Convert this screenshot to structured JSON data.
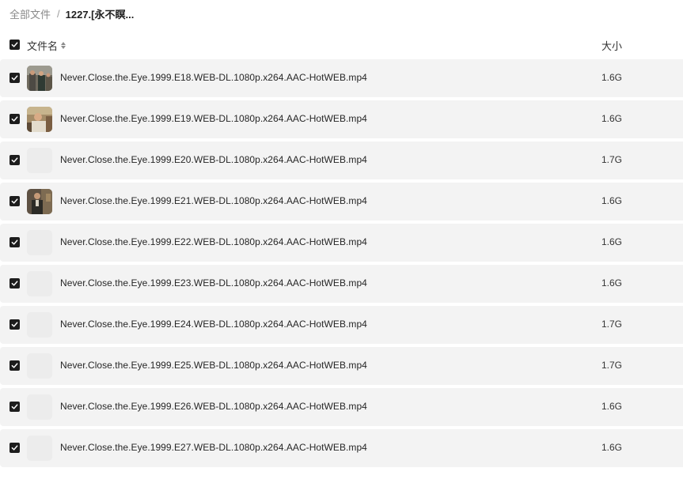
{
  "breadcrumb": {
    "root": "全部文件",
    "separator": "/",
    "current": "1227.[永不瞑..."
  },
  "header": {
    "name_label": "文件名",
    "size_label": "大小",
    "select_all_checked": true
  },
  "files": [
    {
      "name": "Never.Close.the.Eye.1999.E18.WEB-DL.1080p.x264.AAC-HotWEB.mp4",
      "size": "1.6G",
      "thumb": "scene-a",
      "checked": true
    },
    {
      "name": "Never.Close.the.Eye.1999.E19.WEB-DL.1080p.x264.AAC-HotWEB.mp4",
      "size": "1.6G",
      "thumb": "scene-b",
      "checked": true
    },
    {
      "name": "Never.Close.the.Eye.1999.E20.WEB-DL.1080p.x264.AAC-HotWEB.mp4",
      "size": "1.7G",
      "thumb": "placeholder",
      "checked": true
    },
    {
      "name": "Never.Close.the.Eye.1999.E21.WEB-DL.1080p.x264.AAC-HotWEB.mp4",
      "size": "1.6G",
      "thumb": "scene-c",
      "checked": true
    },
    {
      "name": "Never.Close.the.Eye.1999.E22.WEB-DL.1080p.x264.AAC-HotWEB.mp4",
      "size": "1.6G",
      "thumb": "placeholder",
      "checked": true
    },
    {
      "name": "Never.Close.the.Eye.1999.E23.WEB-DL.1080p.x264.AAC-HotWEB.mp4",
      "size": "1.6G",
      "thumb": "placeholder",
      "checked": true
    },
    {
      "name": "Never.Close.the.Eye.1999.E24.WEB-DL.1080p.x264.AAC-HotWEB.mp4",
      "size": "1.7G",
      "thumb": "placeholder",
      "checked": true
    },
    {
      "name": "Never.Close.the.Eye.1999.E25.WEB-DL.1080p.x264.AAC-HotWEB.mp4",
      "size": "1.7G",
      "thumb": "placeholder",
      "checked": true
    },
    {
      "name": "Never.Close.the.Eye.1999.E26.WEB-DL.1080p.x264.AAC-HotWEB.mp4",
      "size": "1.6G",
      "thumb": "placeholder",
      "checked": true
    },
    {
      "name": "Never.Close.the.Eye.1999.E27.WEB-DL.1080p.x264.AAC-HotWEB.mp4",
      "size": "1.6G",
      "thumb": "placeholder",
      "checked": true
    }
  ],
  "colors": {
    "row_background": "#f3f3f3",
    "checkbox": "#1d1d1d",
    "muted_text": "#8a8a8a"
  }
}
